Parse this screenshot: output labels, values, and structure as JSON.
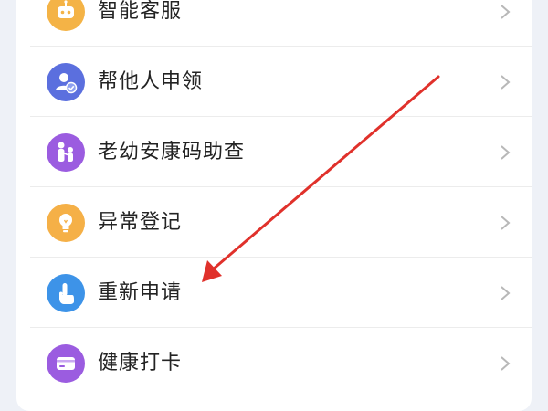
{
  "menu": {
    "items": [
      {
        "label": "智能客服",
        "icon": "robot-icon",
        "color": "#f4b346"
      },
      {
        "label": "帮他人申领",
        "icon": "person-check-icon",
        "color": "#5b6fde"
      },
      {
        "label": "老幼安康码助查",
        "icon": "family-icon",
        "color": "#9b5ce0"
      },
      {
        "label": "异常登记",
        "icon": "lightbulb-icon",
        "color": "#f5b047"
      },
      {
        "label": "重新申请",
        "icon": "tap-hand-icon",
        "color": "#3d93e8"
      },
      {
        "label": "健康打卡",
        "icon": "wallet-card-icon",
        "color": "#9b5ce0"
      }
    ]
  },
  "annotation": {
    "icon": "red-arrow-icon",
    "color": "#e0312b"
  },
  "theme": {
    "background": "#eef1f7",
    "card": "#ffffff",
    "chevron": "#b8b8b8"
  }
}
